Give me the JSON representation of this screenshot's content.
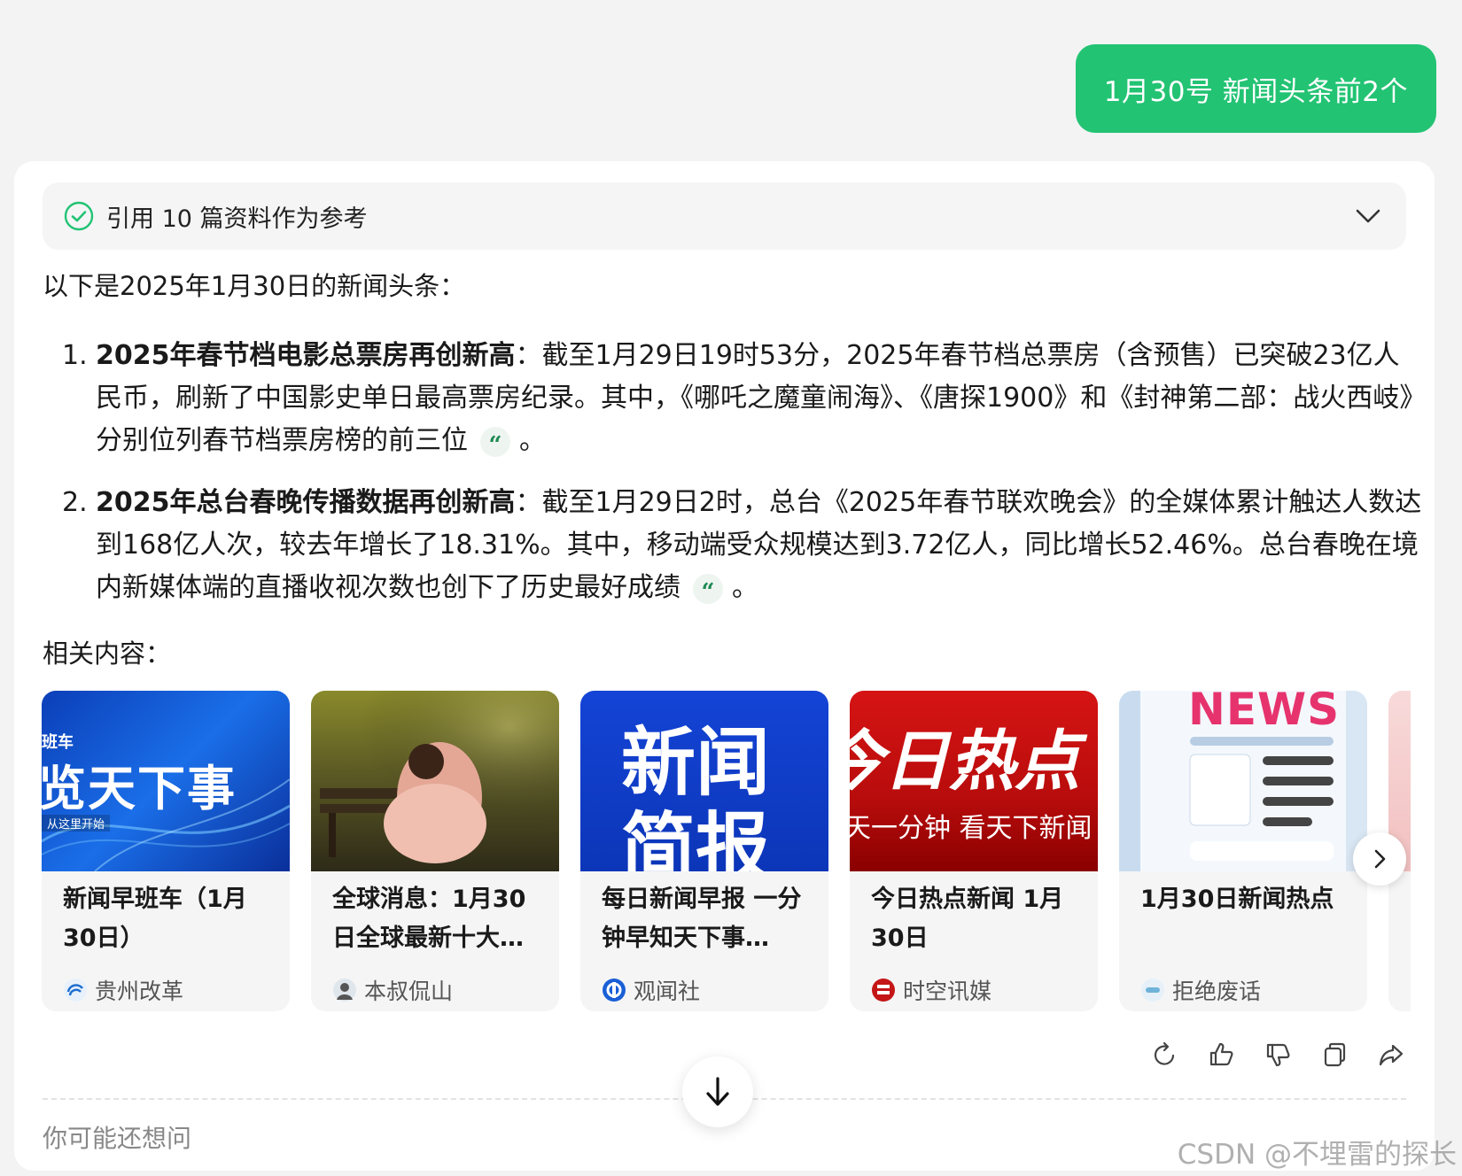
{
  "user_message": "1月30号 新闻头条前2个",
  "references": {
    "label": "引用 10 篇资料作为参考",
    "icon": "check-circle-icon"
  },
  "answer": {
    "intro": "以下是2025年1月30日的新闻头条：",
    "items": [
      {
        "num": "1.",
        "title": "2025年春节档电影总票房再创新高",
        "body": "：截至1月29日19时53分，2025年春节档总票房（含预售）已突破23亿人民币，刷新了中国影史单日最高票房纪录。其中，《哪吒之魔童闹海》、《唐探1900》和《封神第二部：战火西岐》分别位列春节档票房榜的前三位",
        "end": "。"
      },
      {
        "num": "2.",
        "title": "2025年总台春晚传播数据再创新高",
        "body": "：截至1月29日2时，总台《2025年春节联欢晚会》的全媒体累计触达人数达到168亿人次，较去年增长了18.31%。其中，移动端受众规模达到3.72亿人，同比增长52.46%。总台春晚在境内新媒体端的直播收视次数也创下了历史最好成绩",
        "end": "。"
      }
    ],
    "quote_mark": "“"
  },
  "related": {
    "title": "相关内容：",
    "cards": [
      {
        "title": "新闻早班车（1月30日）",
        "source": "贵州改革",
        "thumb_text_small": "班车",
        "thumb_text_big": "览天下事",
        "thumb_text_sub": "从这里开始"
      },
      {
        "title": "全球消息：1月30日全球最新十大…",
        "source": "本叔侃山"
      },
      {
        "title": "每日新闻早报 一分钟早知天下事…",
        "source": "观闻社",
        "thumb_text_big": "新闻",
        "thumb_text_big2": "简报"
      },
      {
        "title": "今日热点新闻 1月30日",
        "source": "时空讯媒",
        "thumb_text_big": "今日热点",
        "thumb_text_sub": "天一分钟  看天下新闻"
      },
      {
        "title": "1月30日新闻热点",
        "source": "拒绝废话",
        "thumb_text_big": "NEWS"
      }
    ]
  },
  "actions": [
    "refresh-icon",
    "thumbs-up-icon",
    "thumbs-down-icon",
    "copy-icon",
    "share-icon"
  ],
  "maybe_ask": "你可能还想问",
  "watermark": "CSDN @不埋雷的探长",
  "colors": {
    "accent": "#22c373",
    "quote_green": "#1e8a52"
  }
}
